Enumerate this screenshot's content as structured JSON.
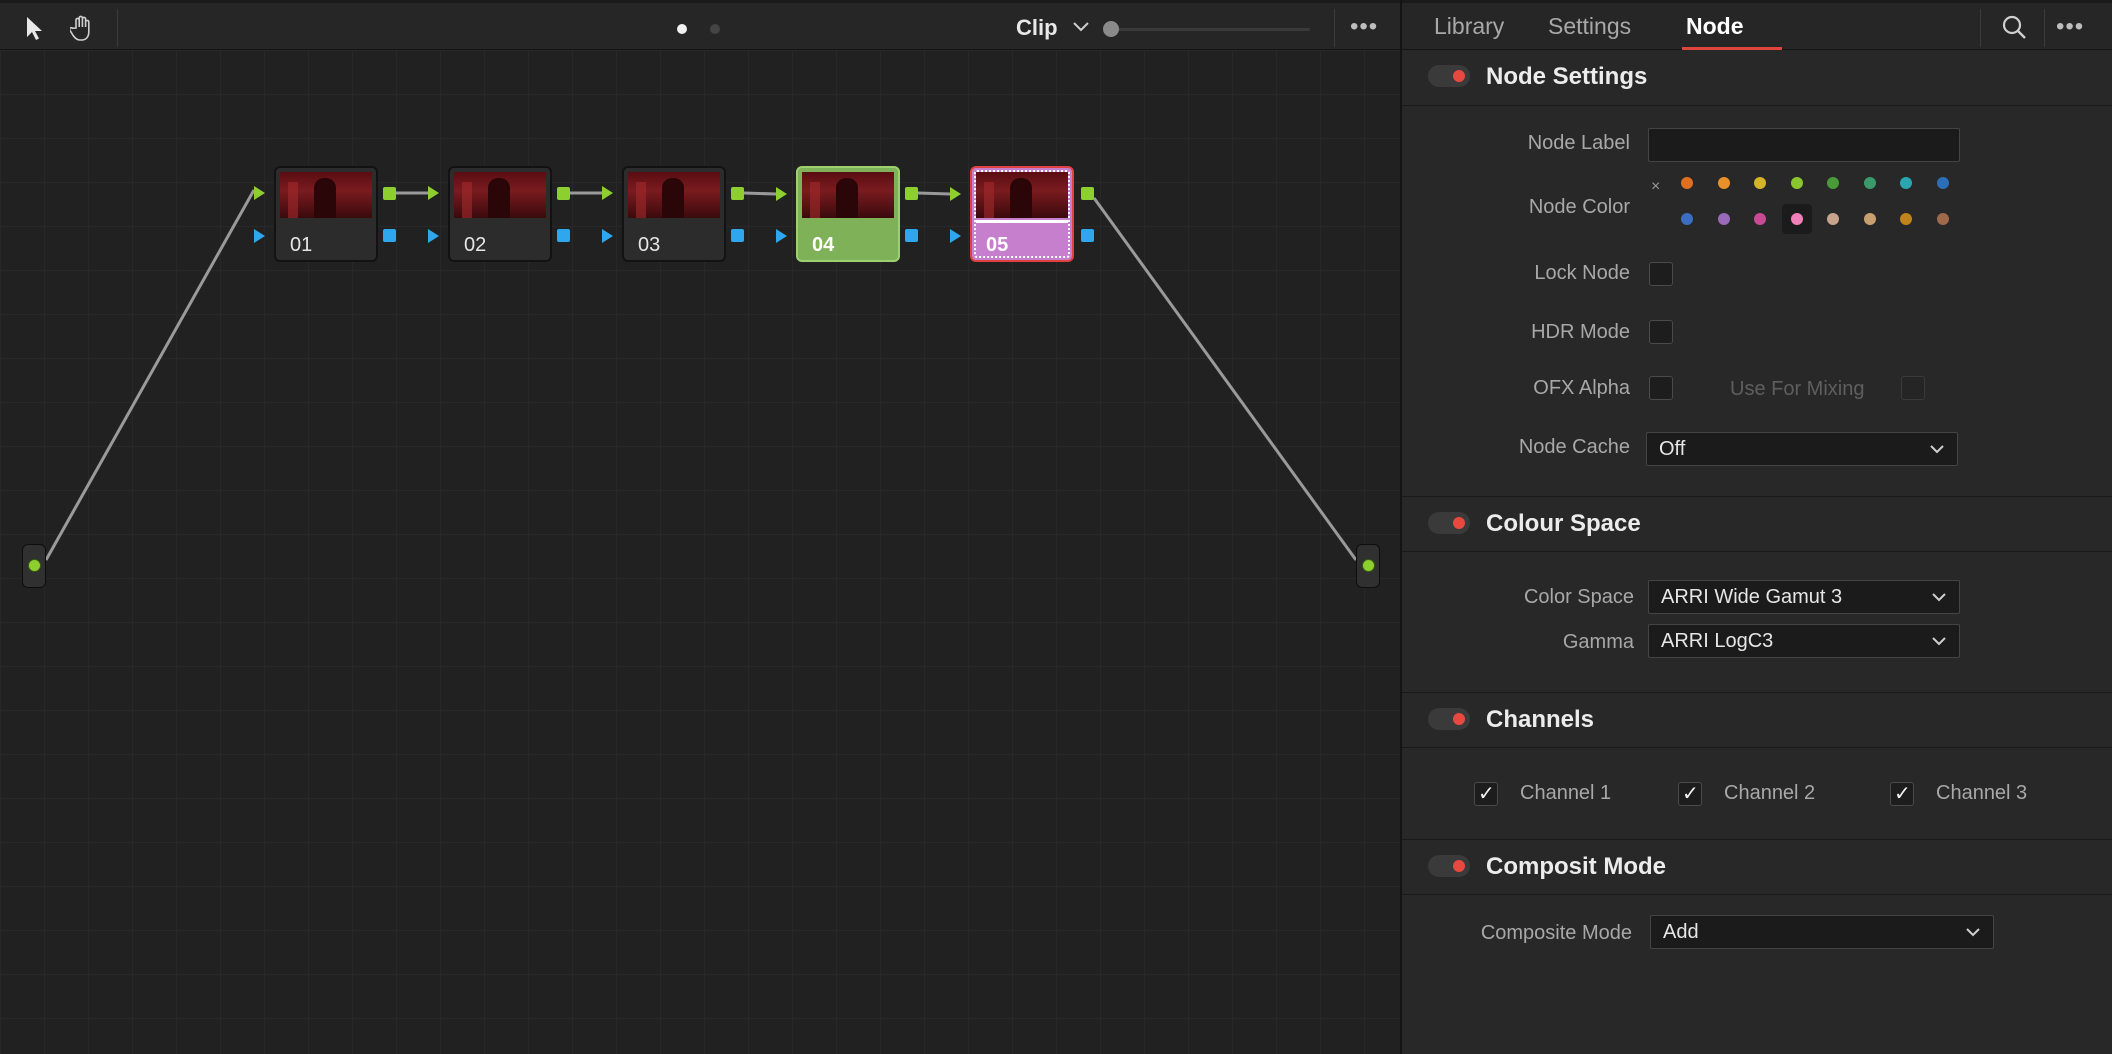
{
  "toolbar": {
    "clip_label": "Clip",
    "more_label": "•••"
  },
  "nodes": [
    {
      "num": "01",
      "style": "normal"
    },
    {
      "num": "02",
      "style": "normal"
    },
    {
      "num": "03",
      "style": "normal"
    },
    {
      "num": "04",
      "style": "green"
    },
    {
      "num": "05",
      "style": "pink-selected"
    }
  ],
  "tabs": {
    "library": "Library",
    "settings": "Settings",
    "node": "Node",
    "more": "•••"
  },
  "node_settings": {
    "title": "Node Settings",
    "node_label_label": "Node Label",
    "node_label_value": "",
    "node_color_label": "Node Color",
    "clear_symbol": "×",
    "colors_row1": [
      "#e07020",
      "#e8902a",
      "#d6b428",
      "#8ac630",
      "#4a9a3a",
      "#3a9a6a",
      "#2aa6b0",
      "#2a6fb8"
    ],
    "colors_row2": [
      "#3b6ec0",
      "#9a6ab8",
      "#c84a94",
      "#f080b8",
      "#c8a48c",
      "#c8a070",
      "#c0841a",
      "#a06a4a"
    ],
    "selected_color": "#f080b8",
    "lock_node_label": "Lock Node",
    "hdr_mode_label": "HDR Mode",
    "ofx_alpha_label": "OFX Alpha",
    "use_for_mixing_label": "Use For Mixing",
    "node_cache_label": "Node Cache",
    "node_cache_value": "Off"
  },
  "colour_space": {
    "title": "Colour Space",
    "color_space_label": "Color Space",
    "color_space_value": "ARRI Wide Gamut 3",
    "gamma_label": "Gamma",
    "gamma_value": "ARRI LogC3"
  },
  "channels": {
    "title": "Channels",
    "items": [
      {
        "label": "Channel 1",
        "checked": true
      },
      {
        "label": "Channel 2",
        "checked": true
      },
      {
        "label": "Channel 3",
        "checked": true
      }
    ]
  },
  "composite": {
    "title": "Composit Mode",
    "mode_label": "Composite Mode",
    "mode_value": "Add"
  },
  "colors": {
    "accent_red": "#e8493f",
    "port_green": "#8ccf2f",
    "port_blue": "#2ea7ee",
    "node_green": "#7fb158",
    "node_pink": "#c57fcc"
  }
}
